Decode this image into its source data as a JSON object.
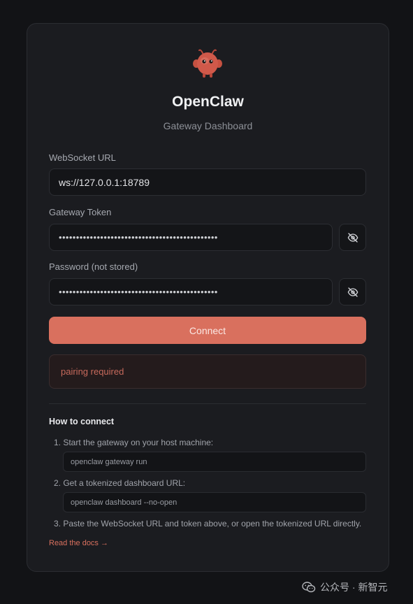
{
  "app": {
    "title": "OpenClaw",
    "subtitle": "Gateway Dashboard"
  },
  "form": {
    "websocket_label": "WebSocket URL",
    "websocket_value": "ws://127.0.0.1:18789",
    "token_label": "Gateway Token",
    "token_value": "••••••••••••••••••••••••••••••••••••••••••••••",
    "password_label": "Password (not stored)",
    "password_value": "••••••••••••••••••••••••••••••••••••••••••••••",
    "connect_label": "Connect"
  },
  "status": {
    "error_text": "pairing required"
  },
  "howto": {
    "title": "How to connect",
    "steps": [
      "1. Start the gateway on your host machine:",
      "2. Get a tokenized dashboard URL:",
      "3. Paste the WebSocket URL and token above, or open the tokenized URL directly."
    ],
    "commands": [
      "openclaw gateway run",
      "openclaw dashboard --no-open"
    ],
    "docs_link": "Read the docs →"
  },
  "watermark": {
    "text": "公众号 · 新智元"
  },
  "colors": {
    "accent": "#d9705e",
    "background": "#121316",
    "card": "#1b1c20",
    "error_text": "#c76a5c"
  },
  "icons": {
    "logo": "red-lobster-mascot",
    "token_toggle": "eye-off-icon",
    "password_toggle": "eye-off-icon",
    "watermark": "wechat-icon"
  }
}
